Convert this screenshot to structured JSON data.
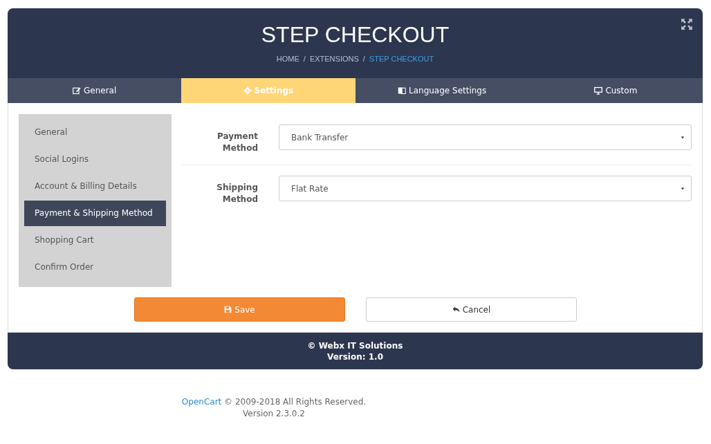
{
  "header": {
    "title": "STEP CHECKOUT",
    "breadcrumbs": [
      {
        "label": "HOME",
        "selected": false
      },
      {
        "label": "EXTENSIONS",
        "selected": false
      },
      {
        "label": "STEP CHECKOUT",
        "selected": true
      }
    ],
    "separator": "/"
  },
  "tabs": [
    {
      "label": "General",
      "selected": false
    },
    {
      "label": "Settings",
      "selected": true
    },
    {
      "label": "Language Settings",
      "selected": false
    },
    {
      "label": "Custom",
      "selected": false
    }
  ],
  "sidebar": {
    "items": [
      {
        "label": "General",
        "selected": false
      },
      {
        "label": "Social Logins",
        "selected": false
      },
      {
        "label": "Account & Billing Details",
        "selected": false
      },
      {
        "label": "Payment & Shipping Method",
        "selected": true
      },
      {
        "label": "Shopping Cart",
        "selected": false
      },
      {
        "label": "Confirm Order",
        "selected": false
      }
    ]
  },
  "form": {
    "fields": [
      {
        "label": "Payment Method",
        "value": "Bank Transfer"
      },
      {
        "label": "Shipping Method",
        "value": "Flat Rate"
      }
    ]
  },
  "buttons": [
    {
      "label": "Save",
      "kind": "primary"
    },
    {
      "label": "Cancel",
      "kind": "secondary"
    }
  ],
  "panel_footer": {
    "company": "© Webx IT Solutions",
    "version": "Version: 1.0"
  },
  "page_footer": {
    "link": "OpenCart",
    "text": "© 2009-2018 All Rights Reserved.",
    "version": "Version 2.3.0.2"
  }
}
